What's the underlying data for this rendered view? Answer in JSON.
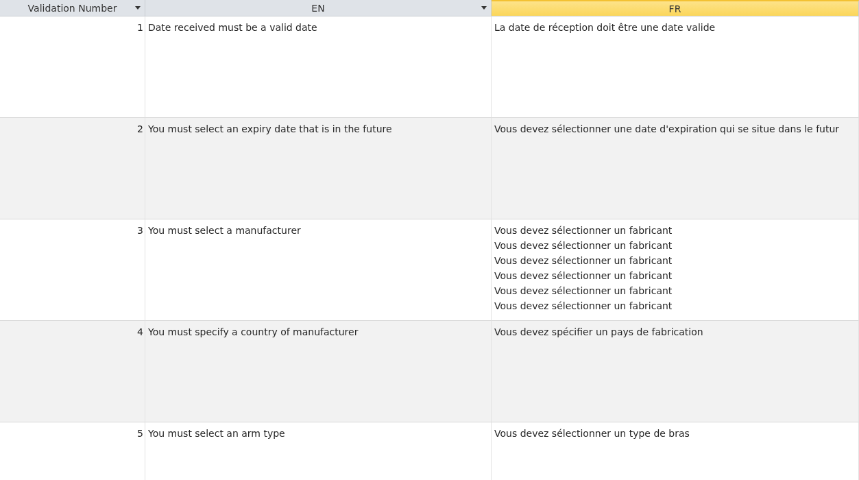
{
  "table": {
    "columns": [
      {
        "label": "Validation Number",
        "selected": false,
        "dropdown": true
      },
      {
        "label": "EN",
        "selected": false,
        "dropdown": true
      },
      {
        "label": "FR",
        "selected": true,
        "dropdown": false
      }
    ],
    "rows": [
      {
        "number": "1",
        "en": "Date received must be a valid date",
        "fr": [
          "La date de réception doit être une date valide"
        ]
      },
      {
        "number": "2",
        "en": "You must select an expiry date that is in the future",
        "fr": [
          "Vous devez sélectionner une date d'expiration qui se situe dans le futur"
        ]
      },
      {
        "number": "3",
        "en": "You must select a manufacturer",
        "fr": [
          "Vous devez sélectionner un fabricant",
          "Vous devez sélectionner un fabricant",
          "Vous devez sélectionner un fabricant",
          "Vous devez sélectionner un fabricant",
          "Vous devez sélectionner un fabricant",
          "Vous devez sélectionner un fabricant"
        ]
      },
      {
        "number": "4",
        "en": "You must specify a country of manufacturer",
        "fr": [
          "Vous devez spécifier un pays de fabrication"
        ]
      },
      {
        "number": "5",
        "en": "You must select an arm type",
        "fr": [
          "Vous devez sélectionner un type de bras"
        ]
      }
    ]
  }
}
